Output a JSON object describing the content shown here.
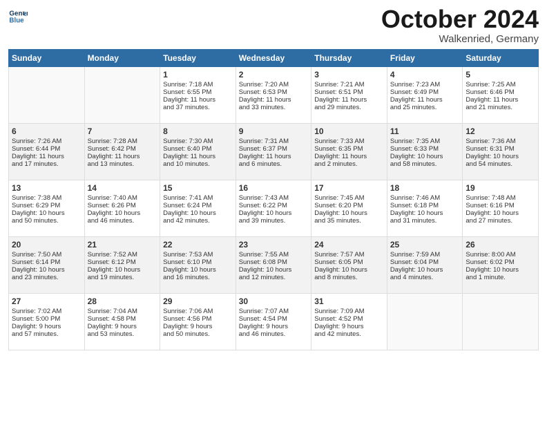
{
  "logo": {
    "line1": "General",
    "line2": "Blue"
  },
  "title": "October 2024",
  "subtitle": "Walkenried, Germany",
  "weekdays": [
    "Sunday",
    "Monday",
    "Tuesday",
    "Wednesday",
    "Thursday",
    "Friday",
    "Saturday"
  ],
  "weeks": [
    [
      {
        "day": "",
        "content": ""
      },
      {
        "day": "",
        "content": ""
      },
      {
        "day": "1",
        "content": "Sunrise: 7:18 AM\nSunset: 6:55 PM\nDaylight: 11 hours\nand 37 minutes."
      },
      {
        "day": "2",
        "content": "Sunrise: 7:20 AM\nSunset: 6:53 PM\nDaylight: 11 hours\nand 33 minutes."
      },
      {
        "day": "3",
        "content": "Sunrise: 7:21 AM\nSunset: 6:51 PM\nDaylight: 11 hours\nand 29 minutes."
      },
      {
        "day": "4",
        "content": "Sunrise: 7:23 AM\nSunset: 6:49 PM\nDaylight: 11 hours\nand 25 minutes."
      },
      {
        "day": "5",
        "content": "Sunrise: 7:25 AM\nSunset: 6:46 PM\nDaylight: 11 hours\nand 21 minutes."
      }
    ],
    [
      {
        "day": "6",
        "content": "Sunrise: 7:26 AM\nSunset: 6:44 PM\nDaylight: 11 hours\nand 17 minutes."
      },
      {
        "day": "7",
        "content": "Sunrise: 7:28 AM\nSunset: 6:42 PM\nDaylight: 11 hours\nand 13 minutes."
      },
      {
        "day": "8",
        "content": "Sunrise: 7:30 AM\nSunset: 6:40 PM\nDaylight: 11 hours\nand 10 minutes."
      },
      {
        "day": "9",
        "content": "Sunrise: 7:31 AM\nSunset: 6:37 PM\nDaylight: 11 hours\nand 6 minutes."
      },
      {
        "day": "10",
        "content": "Sunrise: 7:33 AM\nSunset: 6:35 PM\nDaylight: 11 hours\nand 2 minutes."
      },
      {
        "day": "11",
        "content": "Sunrise: 7:35 AM\nSunset: 6:33 PM\nDaylight: 10 hours\nand 58 minutes."
      },
      {
        "day": "12",
        "content": "Sunrise: 7:36 AM\nSunset: 6:31 PM\nDaylight: 10 hours\nand 54 minutes."
      }
    ],
    [
      {
        "day": "13",
        "content": "Sunrise: 7:38 AM\nSunset: 6:29 PM\nDaylight: 10 hours\nand 50 minutes."
      },
      {
        "day": "14",
        "content": "Sunrise: 7:40 AM\nSunset: 6:26 PM\nDaylight: 10 hours\nand 46 minutes."
      },
      {
        "day": "15",
        "content": "Sunrise: 7:41 AM\nSunset: 6:24 PM\nDaylight: 10 hours\nand 42 minutes."
      },
      {
        "day": "16",
        "content": "Sunrise: 7:43 AM\nSunset: 6:22 PM\nDaylight: 10 hours\nand 39 minutes."
      },
      {
        "day": "17",
        "content": "Sunrise: 7:45 AM\nSunset: 6:20 PM\nDaylight: 10 hours\nand 35 minutes."
      },
      {
        "day": "18",
        "content": "Sunrise: 7:46 AM\nSunset: 6:18 PM\nDaylight: 10 hours\nand 31 minutes."
      },
      {
        "day": "19",
        "content": "Sunrise: 7:48 AM\nSunset: 6:16 PM\nDaylight: 10 hours\nand 27 minutes."
      }
    ],
    [
      {
        "day": "20",
        "content": "Sunrise: 7:50 AM\nSunset: 6:14 PM\nDaylight: 10 hours\nand 23 minutes."
      },
      {
        "day": "21",
        "content": "Sunrise: 7:52 AM\nSunset: 6:12 PM\nDaylight: 10 hours\nand 19 minutes."
      },
      {
        "day": "22",
        "content": "Sunrise: 7:53 AM\nSunset: 6:10 PM\nDaylight: 10 hours\nand 16 minutes."
      },
      {
        "day": "23",
        "content": "Sunrise: 7:55 AM\nSunset: 6:08 PM\nDaylight: 10 hours\nand 12 minutes."
      },
      {
        "day": "24",
        "content": "Sunrise: 7:57 AM\nSunset: 6:05 PM\nDaylight: 10 hours\nand 8 minutes."
      },
      {
        "day": "25",
        "content": "Sunrise: 7:59 AM\nSunset: 6:04 PM\nDaylight: 10 hours\nand 4 minutes."
      },
      {
        "day": "26",
        "content": "Sunrise: 8:00 AM\nSunset: 6:02 PM\nDaylight: 10 hours\nand 1 minute."
      }
    ],
    [
      {
        "day": "27",
        "content": "Sunrise: 7:02 AM\nSunset: 5:00 PM\nDaylight: 9 hours\nand 57 minutes."
      },
      {
        "day": "28",
        "content": "Sunrise: 7:04 AM\nSunset: 4:58 PM\nDaylight: 9 hours\nand 53 minutes."
      },
      {
        "day": "29",
        "content": "Sunrise: 7:06 AM\nSunset: 4:56 PM\nDaylight: 9 hours\nand 50 minutes."
      },
      {
        "day": "30",
        "content": "Sunrise: 7:07 AM\nSunset: 4:54 PM\nDaylight: 9 hours\nand 46 minutes."
      },
      {
        "day": "31",
        "content": "Sunrise: 7:09 AM\nSunset: 4:52 PM\nDaylight: 9 hours\nand 42 minutes."
      },
      {
        "day": "",
        "content": ""
      },
      {
        "day": "",
        "content": ""
      }
    ]
  ]
}
